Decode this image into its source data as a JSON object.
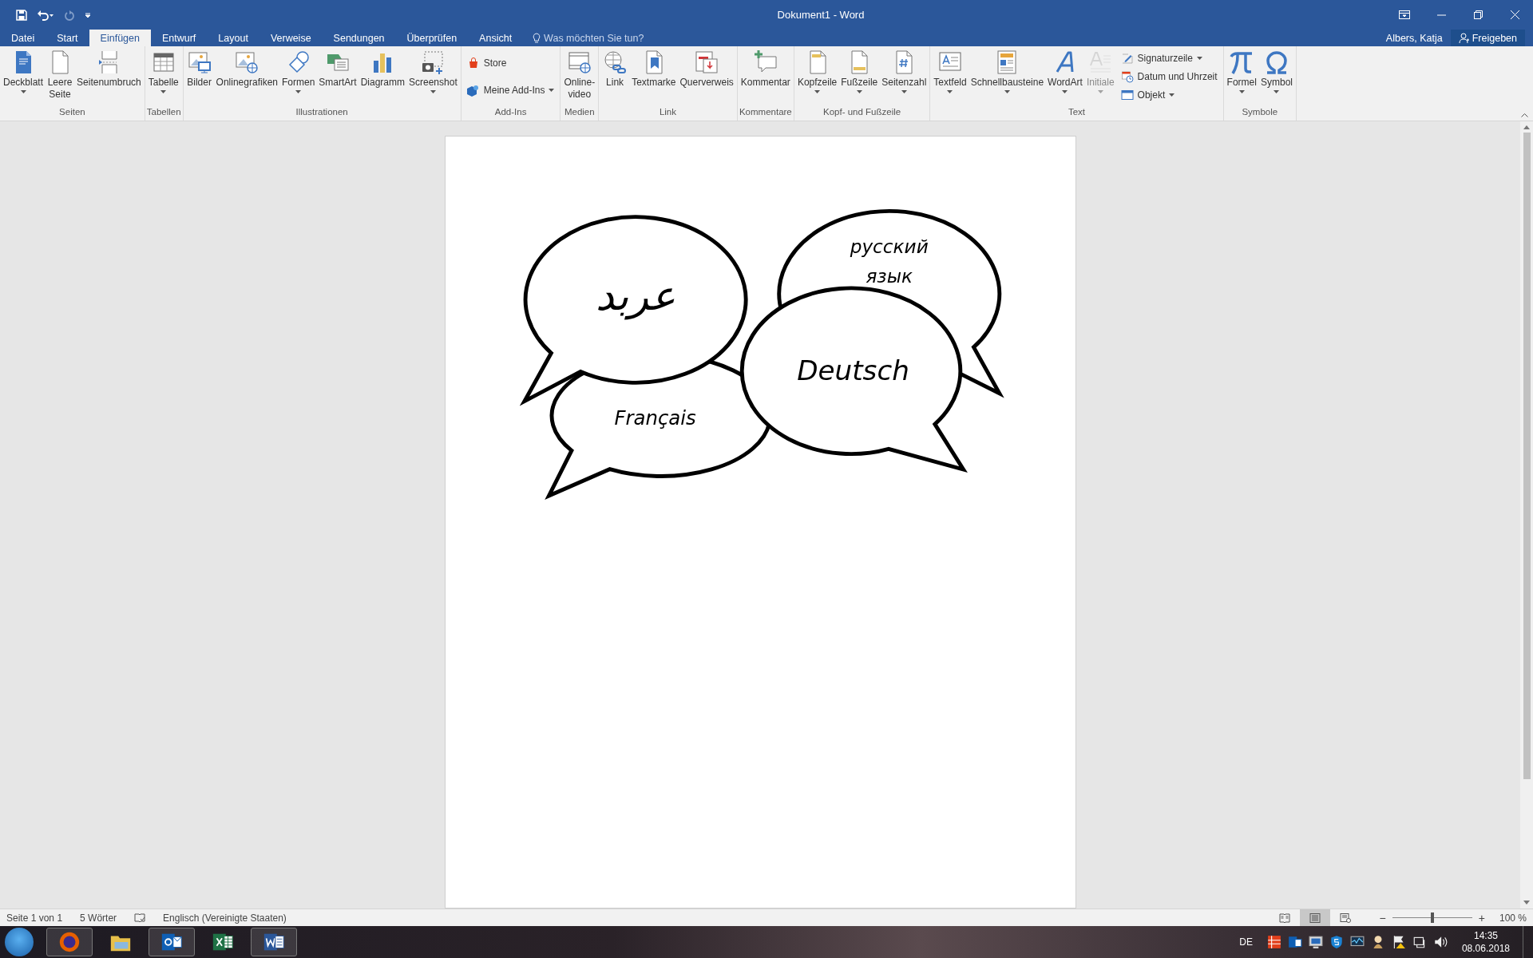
{
  "window": {
    "title": "Dokument1 - Word"
  },
  "tabs": [
    {
      "label": "Datei",
      "selected": false
    },
    {
      "label": "Start",
      "selected": false
    },
    {
      "label": "Einfügen",
      "selected": true
    },
    {
      "label": "Entwurf",
      "selected": false
    },
    {
      "label": "Layout",
      "selected": false
    },
    {
      "label": "Verweise",
      "selected": false
    },
    {
      "label": "Sendungen",
      "selected": false
    },
    {
      "label": "Überprüfen",
      "selected": false
    },
    {
      "label": "Ansicht",
      "selected": false
    }
  ],
  "tell_me": {
    "placeholder": "Was möchten Sie tun?"
  },
  "user": "Albers, Katja",
  "share_button": "Freigeben",
  "ribbon": {
    "groups": [
      {
        "label": "Seiten",
        "items": [
          {
            "kind": "large",
            "label": "Deckblatt",
            "dropdown": true,
            "disabled": false
          },
          {
            "kind": "large",
            "label": "Leere\nSeite",
            "dropdown": false,
            "disabled": false
          },
          {
            "kind": "large",
            "label": "Seitenumbruch",
            "dropdown": false,
            "disabled": false
          }
        ]
      },
      {
        "label": "Tabellen",
        "items": [
          {
            "kind": "large",
            "label": "Tabelle",
            "dropdown": true,
            "disabled": false
          }
        ]
      },
      {
        "label": "Illustrationen",
        "items": [
          {
            "kind": "large",
            "label": "Bilder",
            "dropdown": false,
            "disabled": false
          },
          {
            "kind": "large",
            "label": "Onlinegrafiken",
            "dropdown": false,
            "disabled": false
          },
          {
            "kind": "large",
            "label": "Formen",
            "dropdown": true,
            "disabled": false
          },
          {
            "kind": "large",
            "label": "SmartArt",
            "dropdown": false,
            "disabled": false
          },
          {
            "kind": "large",
            "label": "Diagramm",
            "dropdown": false,
            "disabled": false
          },
          {
            "kind": "large",
            "label": "Screenshot",
            "dropdown": true,
            "disabled": false
          }
        ]
      },
      {
        "label": "Add-Ins",
        "items": [
          {
            "kind": "small",
            "label": "Store",
            "dropdown": false,
            "disabled": false
          },
          {
            "kind": "small",
            "label": "Meine Add-Ins",
            "dropdown": true,
            "disabled": false
          }
        ]
      },
      {
        "label": "Medien",
        "items": [
          {
            "kind": "large",
            "label": "Online-\nvideo",
            "dropdown": false,
            "disabled": false
          }
        ]
      },
      {
        "label": "Link",
        "items": [
          {
            "kind": "large",
            "label": "Link",
            "dropdown": false,
            "disabled": false
          },
          {
            "kind": "large",
            "label": "Textmarke",
            "dropdown": false,
            "disabled": false
          },
          {
            "kind": "large",
            "label": "Querverweis",
            "dropdown": false,
            "disabled": false
          }
        ]
      },
      {
        "label": "Kommentare",
        "items": [
          {
            "kind": "large",
            "label": "Kommentar",
            "dropdown": false,
            "disabled": false
          }
        ]
      },
      {
        "label": "Kopf- und Fußzeile",
        "items": [
          {
            "kind": "large",
            "label": "Kopfzeile",
            "dropdown": true,
            "disabled": false
          },
          {
            "kind": "large",
            "label": "Fußzeile",
            "dropdown": true,
            "disabled": false
          },
          {
            "kind": "large",
            "label": "Seitenzahl",
            "dropdown": true,
            "disabled": false
          }
        ]
      },
      {
        "label": "Text",
        "items": [
          {
            "kind": "large",
            "label": "Textfeld",
            "dropdown": true,
            "disabled": false
          },
          {
            "kind": "large",
            "label": "Schnellbausteine",
            "dropdown": true,
            "disabled": false
          },
          {
            "kind": "large",
            "label": "WordArt",
            "dropdown": true,
            "disabled": false
          },
          {
            "kind": "large",
            "label": "Initiale",
            "dropdown": true,
            "disabled": true
          },
          {
            "kind": "small",
            "label": "Signaturzeile",
            "dropdown": true,
            "disabled": false
          },
          {
            "kind": "small",
            "label": "Datum und Uhrzeit",
            "dropdown": false,
            "disabled": false
          },
          {
            "kind": "small",
            "label": "Objekt",
            "dropdown": true,
            "disabled": false
          }
        ]
      },
      {
        "label": "Symbole",
        "items": [
          {
            "kind": "large",
            "label": "Formel",
            "dropdown": true,
            "disabled": false
          },
          {
            "kind": "large",
            "label": "Symbol",
            "dropdown": true,
            "disabled": false
          }
        ]
      }
    ]
  },
  "document": {
    "bubbles": [
      {
        "lines": [
          "Français"
        ]
      },
      {
        "lines": [
          "русский",
          "язык"
        ]
      },
      {
        "lines": [
          "عربد"
        ]
      },
      {
        "lines": [
          "Deutsch"
        ]
      }
    ]
  },
  "status_bar": {
    "page": "Seite 1 von 1",
    "words": "5 Wörter",
    "language": "Englisch (Vereinigte Staaten)",
    "views": [
      {
        "selected": false
      },
      {
        "selected": true
      },
      {
        "selected": false
      }
    ],
    "zoom": {
      "minus": "−",
      "plus": "+",
      "level": 0.5,
      "reading": "100 %"
    }
  },
  "taskbar": {
    "apps": [
      {
        "running": true
      },
      {
        "running": false
      },
      {
        "running": true
      },
      {
        "running": false
      },
      {
        "running": true
      }
    ],
    "language": "DE",
    "time": "14:35",
    "date": "08.06.2018"
  }
}
